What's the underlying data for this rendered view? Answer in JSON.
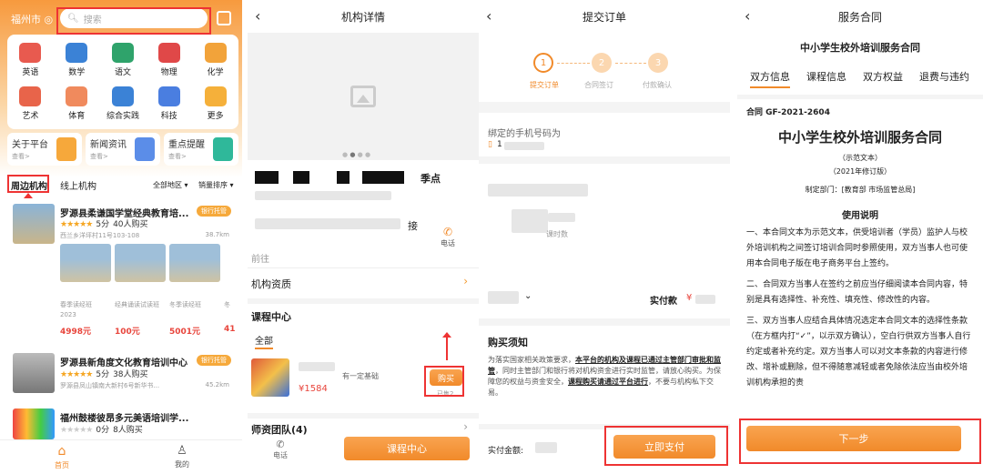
{
  "p1": {
    "city": "福州市",
    "search_placeholder": "搜索",
    "categories": [
      {
        "label": "英语",
        "color": "#e85a4f"
      },
      {
        "label": "数学",
        "color": "#3b82d6"
      },
      {
        "label": "语文",
        "color": "#2fa36b"
      },
      {
        "label": "物理",
        "color": "#e04848"
      },
      {
        "label": "化学",
        "color": "#f2a33a"
      },
      {
        "label": "艺术",
        "color": "#e8644a"
      },
      {
        "label": "体育",
        "color": "#f08a5d"
      },
      {
        "label": "综合实践",
        "color": "#3b82d6"
      },
      {
        "label": "科技",
        "color": "#4a7ee0"
      },
      {
        "label": "更多",
        "color": "#f5b03a"
      }
    ],
    "cards": [
      {
        "title": "关于平台",
        "sub": "查看>",
        "color": "#f6a83b"
      },
      {
        "title": "新闻资讯",
        "sub": "查看>",
        "color": "#5b8de8"
      },
      {
        "title": "重点提醒",
        "sub": "查看>",
        "color": "#2fb89a"
      }
    ],
    "tab_nearby": "周边机构",
    "tab_online": "线上机构",
    "filter_region": "全部地区",
    "filter_sort": "销量排序",
    "inst1": {
      "name": "罗源县柔谦国学堂经典教育培...",
      "badge": "银行托管",
      "rating": "5分",
      "buyers": "40人购买",
      "addr": "西兰乡洋坪村11号103-108",
      "dist": "38.7km",
      "courses": [
        {
          "name": "春季读经班 2023",
          "price": "4998元"
        },
        {
          "name": "经典诵读试读班",
          "price": "100元"
        },
        {
          "name": "冬季读经班",
          "price": "5001元"
        },
        {
          "name": "冬",
          "price": "41"
        }
      ]
    },
    "inst2": {
      "name": "罗源县新角度文化教育培训中心",
      "badge": "银行托管",
      "rating": "5分",
      "buyers": "38人购买",
      "addr": "罗源县凤山镇南大新村6号新华书...",
      "dist": "45.2km"
    },
    "inst3": {
      "name": "福州鼓楼彼昂多元美语培训学...",
      "rating": "0分",
      "buyers": "8人购买"
    },
    "nav_home": "首页",
    "nav_mine": "我的"
  },
  "p2": {
    "title": "机构详情",
    "partial1": "季点",
    "partial2": "接",
    "phone_label": "电话",
    "goto": "前往",
    "qual": "机构资质",
    "course_center": "课程中心",
    "all": "全部",
    "course_desc": "有一定基础",
    "course_price": "¥1584",
    "buy": "购买",
    "sold": "已售2",
    "teachers": "师资团队(4)",
    "bottom_phone": "电话",
    "bottom_btn": "课程中心"
  },
  "p3": {
    "title": "提交订单",
    "steps": [
      {
        "n": "1",
        "label": "提交订单"
      },
      {
        "n": "2",
        "label": "合同签订"
      },
      {
        "n": "3",
        "label": "付款确认"
      }
    ],
    "bound_phone": "绑定的手机号码为",
    "phone_prefix": "1",
    "course_time": "课时数",
    "paid_label": "实付款",
    "yen": "¥",
    "notice_title": "购买须知",
    "notice_a": "为落实国家相关政策要求，",
    "notice_b": "本平台的机构及课程已通过主管部门审批和监管",
    "notice_c": "，同时主管部门和银行将对机构资金进行实时监管，请放心购买。为保障您的权益与资金安全，",
    "notice_d": "课程购买请通过平台进行",
    "notice_e": "，不要与机构私下交易。",
    "amount_label": "实付金额:",
    "pay_btn": "立即支付"
  },
  "p4": {
    "title": "服务合同",
    "sub": "中小学生校外培训服务合同",
    "tabs": [
      "双方信息",
      "课程信息",
      "双方权益",
      "退费与违约"
    ],
    "code": "合同 GF-2021-2604",
    "doc_title": "中小学生校外培训服务合同",
    "sample": "（示范文本）",
    "edition": "（2021年修订版）",
    "maker": "制定部门：[教育部 市场监管总局]",
    "usage": "使用说明",
    "para1": "一、本合同文本为示范文本，供受培训者（学员）监护人与校外培训机构之间签订培训合同时参照使用，双方当事人也可使用本合同电子版在电子商务平台上签约。",
    "para2": "二、合同双方当事人在签约之前应当仔细阅读本合同内容，特别是具有选择性、补充性、填充性、修改性的内容。",
    "para3": "三、双方当事人应结合具体情况选定本合同文本的选择性条款（在方框内打“✓”，以示双方确认），空白行供双方当事人自行约定或者补充约定。双方当事人可以对文本条款的内容进行修改、增补或删除，但不得随意减轻或者免除依法应当由校外培训机构承担的责",
    "next": "下一步"
  }
}
